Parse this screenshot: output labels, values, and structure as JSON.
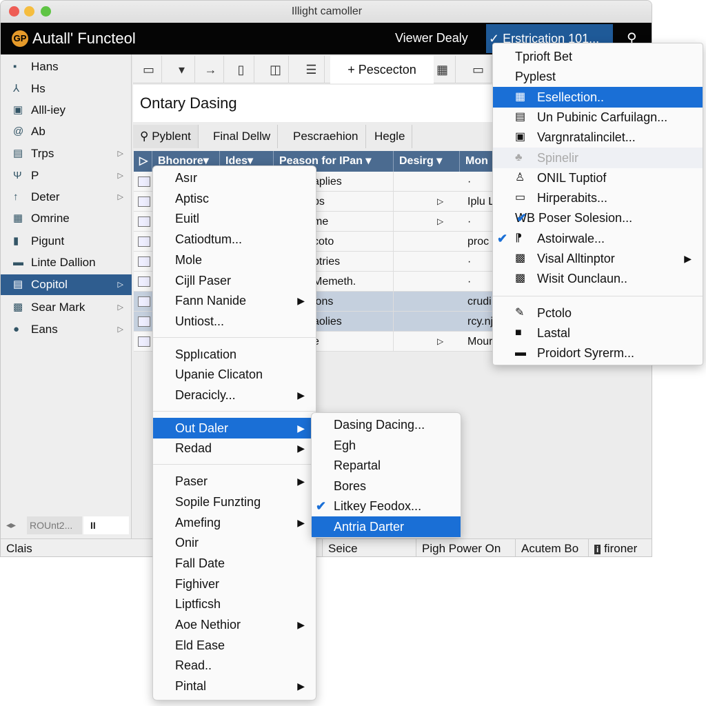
{
  "window": {
    "title": "Illight camoller",
    "traffic": [
      "#ee5d55",
      "#f5bd3f",
      "#5fc444"
    ]
  },
  "appbar": {
    "logo": "GP",
    "app_name": "Autall' Functeol",
    "viewer": "Viewer Dealy",
    "dropdown": "✓ Erstrication 101...",
    "search_icon": "search-icon"
  },
  "sidebar": {
    "items": [
      {
        "label": "Hans",
        "icon": "▪"
      },
      {
        "label": "Hs",
        "icon": "⅄"
      },
      {
        "label": "Alll-iey",
        "icon": "▣"
      },
      {
        "label": "Ab",
        "icon": "@"
      },
      {
        "label": "Trps",
        "icon": "▤",
        "arrow": "▷"
      },
      {
        "label": "P",
        "icon": "Ψ",
        "arrow": "▷"
      },
      {
        "label": "Deter",
        "icon": "↑",
        "arrow": "▷"
      },
      {
        "label": "Omrine",
        "icon": "▦"
      },
      {
        "label": "Pigunt",
        "icon": "▮"
      },
      {
        "label": "Linte Dallion",
        "icon": "▬"
      },
      {
        "label": "Copitol",
        "icon": "▤",
        "arrow": "▷",
        "selected": true
      },
      {
        "label": "Sear Mark",
        "icon": "▩",
        "arrow": "▷"
      },
      {
        "label": "Eans",
        "icon": "●",
        "arrow": "▷"
      }
    ]
  },
  "toolbar": {
    "add_label": "+ Pescecton"
  },
  "heading": "Ontary Dasing",
  "tabs": [
    "Pyblent",
    "Final Dellw",
    "Pescraehion",
    "Hegle"
  ],
  "table": {
    "columns": [
      "Bhonore▾",
      "Ides▾",
      "Peason for IPan ▾",
      "Desirg ▾",
      "Mon"
    ],
    "rows": [
      {
        "c3": "aplies",
        "c5": "·"
      },
      {
        "c3": "ps",
        "arrow": "▷",
        "c5": "Iplu L"
      },
      {
        "c3": "me",
        "arrow": "▷",
        "c5": "·"
      },
      {
        "c3": "coto",
        "c5": "proc"
      },
      {
        "c3": "ptries",
        "c5": "·"
      },
      {
        "c3": "Memeth.",
        "c5": "·"
      },
      {
        "c3": "ions",
        "c5": "crudi",
        "hl": true
      },
      {
        "c3": "aolies",
        "c5": "rcy.nj",
        "hl": true
      },
      {
        "c3": "e",
        "arrow": "▷",
        "c5": "Mour"
      }
    ]
  },
  "bottom_control": {
    "label": "ROUnt2...",
    "pause": "II"
  },
  "statusbar": {
    "left": "Clais",
    "items": [
      "Seice",
      "Pigh Power On",
      "Acutem Bo",
      "fironer"
    ]
  },
  "context_menu": {
    "groups": [
      [
        {
          "label": "Asır"
        },
        {
          "label": "Aptisc"
        },
        {
          "label": "Euitl"
        },
        {
          "label": "Catiodtum..."
        },
        {
          "label": "Mole"
        },
        {
          "label": "Cijll Paser"
        },
        {
          "label": "Fann Nanide",
          "submenu": true
        },
        {
          "label": "Untiost..."
        }
      ],
      [
        {
          "label": "Spplıcation"
        },
        {
          "label": "Upanie Clicaton"
        },
        {
          "label": "Deracicly...",
          "submenu": true
        }
      ],
      [
        {
          "label": "Out Daler",
          "submenu": true,
          "selected": true
        },
        {
          "label": "Redad",
          "submenu": true
        }
      ],
      [
        {
          "label": "Paser",
          "submenu": true
        },
        {
          "label": "Sopile Funzting"
        },
        {
          "label": "Amefing",
          "submenu": true
        },
        {
          "label": "Onir"
        },
        {
          "label": "Fall Date"
        },
        {
          "label": "Fighiver"
        },
        {
          "label": "Liptficsh"
        },
        {
          "label": "Aoe Nethior",
          "submenu": true
        },
        {
          "label": "Eld Ease"
        },
        {
          "label": "Read.."
        },
        {
          "label": "Pintal",
          "submenu": true
        }
      ]
    ]
  },
  "submenu": {
    "items": [
      {
        "label": "Dasing Dacing..."
      },
      {
        "label": "Egh"
      },
      {
        "label": "Repartal"
      },
      {
        "label": "Bores"
      },
      {
        "label": "Litkey Feodox...",
        "checked": true
      },
      {
        "label": "Antria Darter",
        "selected": true
      }
    ]
  },
  "dropdown_menu": {
    "items": [
      {
        "label": "Tprioft Bet"
      },
      {
        "label": "Pyplest"
      },
      {
        "label": "Esellection..",
        "icon": "▦",
        "selected": true
      },
      {
        "label": "Un Pubinic Carfuilagn...",
        "icon": "▤"
      },
      {
        "label": "Vargnratalincilet...",
        "icon": "▣"
      },
      {
        "label": "Spinelir",
        "icon": "♣",
        "disabled": true
      },
      {
        "label": "ONIL Tuptiof",
        "icon": "♙"
      },
      {
        "label": "Hirperabits...",
        "icon": "▭"
      },
      {
        "label": "WB Poser Solesion...",
        "checked": true
      },
      {
        "label": "Astoirwale...",
        "icon": "⁋",
        "checked": true
      },
      {
        "label": "Visal Alltinptor",
        "icon": "▩",
        "submenu": true
      },
      {
        "label": "Wisit Ounclaun..",
        "icon": "▩"
      },
      {
        "label": "Pctolo",
        "icon": "✎",
        "sep": true
      },
      {
        "label": "Lastal",
        "icon": "■"
      },
      {
        "label": "Proidort Syrerm...",
        "icon": "▬"
      }
    ]
  },
  "colors": {
    "accent": "#1a6fd6",
    "header": "#4b6b90",
    "sidebar_selected": "#2f5d8f",
    "appbar": "#050505"
  }
}
